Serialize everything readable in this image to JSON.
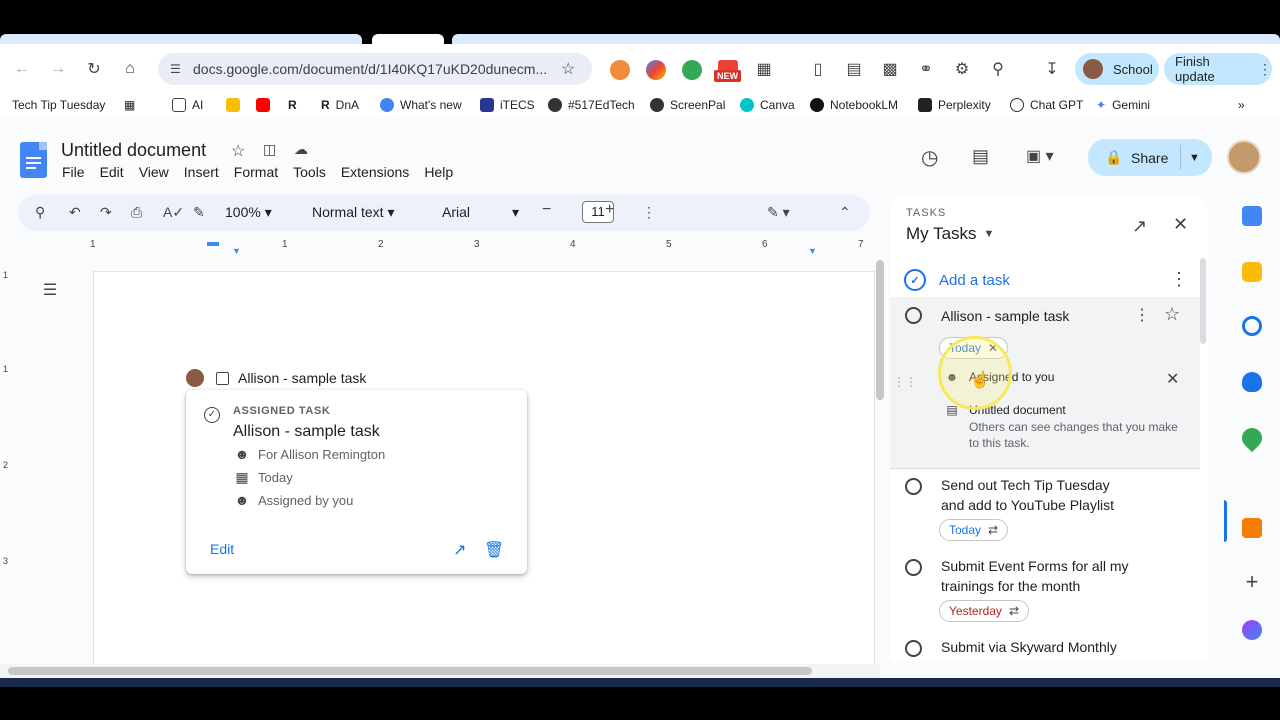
{
  "browser": {
    "url": "docs.google.com/document/d/1I40KQ17uKD20dunecm...",
    "profile_label": "School",
    "update_label": "Finish update",
    "new_badge": "NEW",
    "bookmarks": [
      "Tech Tip Tuesday",
      "AI",
      "DnA",
      "What's new",
      "iTECS",
      "#517EdTech",
      "ScreenPal",
      "Canva",
      "NotebookLM",
      "Perplexity",
      "Chat GPT",
      "Gemini"
    ]
  },
  "doc": {
    "title": "Untitled document",
    "menu": [
      "File",
      "Edit",
      "View",
      "Insert",
      "Format",
      "Tools",
      "Extensions",
      "Help"
    ],
    "share_label": "Share",
    "zoom": "100%",
    "style": "Normal text",
    "font": "Arial",
    "font_size": "11",
    "ruler_numbers": [
      "1",
      "1",
      "2",
      "3",
      "4",
      "5",
      "6",
      "7"
    ],
    "vruler_numbers": [
      "1",
      "1",
      "2",
      "3"
    ],
    "chip_task": "Allison - sample task"
  },
  "task_card": {
    "kicker": "ASSIGNED TASK",
    "title": "Allison - sample task",
    "for": "For Allison Remington",
    "date": "Today",
    "assigned_by": "Assigned by you",
    "edit": "Edit"
  },
  "tasks_panel": {
    "kicker": "TASKS",
    "list_name": "My Tasks",
    "add_task": "Add a task",
    "selected": {
      "title": "Allison - sample task",
      "date_chip": "Today",
      "assigned": "Assigned to you",
      "doc_name": "Untitled document",
      "doc_note": "Others can see changes that you make to this task."
    },
    "items": [
      {
        "title": "Send out Tech Tip Tuesday and add to YouTube Playlist",
        "chip": "Today"
      },
      {
        "title": "Submit Event Forms for all my trainings for the month",
        "chip": "Yesterday"
      },
      {
        "title": "Submit via Skyward Monthly",
        "chip": ""
      }
    ]
  },
  "colors": {
    "accent": "#1a73e8",
    "share_bg": "#c2e7ff",
    "overdue": "#b3261e",
    "highlight": "#f3ea5c"
  }
}
